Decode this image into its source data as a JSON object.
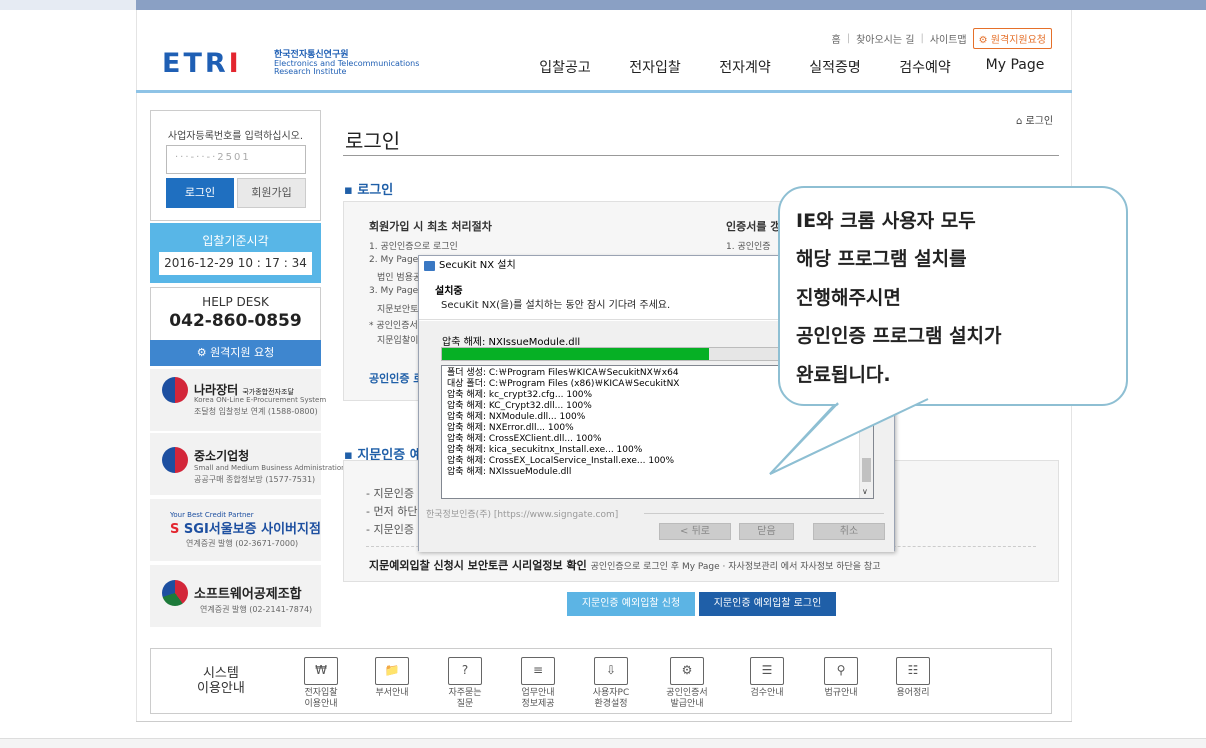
{
  "header": {
    "logo_text_a": "ETR",
    "logo_text_b": "I",
    "logo_org_kr": "한국전자통신연구원",
    "logo_org_en1": "Electronics and Telecommunications",
    "logo_org_en2": "Research Institute",
    "top_links": [
      "홈",
      "찾아오시는 길",
      "사이트맵"
    ],
    "remote_support": "원격지원요청",
    "nav": [
      "입찰공고",
      "전자입찰",
      "전자계약",
      "실적증명",
      "검수예약",
      "My Page"
    ]
  },
  "sidebar": {
    "login_prompt": "사업자등록번호를 입력하십시오.",
    "login_value": "···-··-·2501",
    "login_button": "로그인",
    "join_button": "회원가입",
    "time_title": "입찰기준시각",
    "time_value": "2016-12-29 10 : 17 : 34",
    "help_title": "HELP DESK",
    "help_phone": "042-860-0859",
    "help_remote": "원격지원 요청",
    "banners": [
      {
        "name": "나라장터",
        "tag": "국가종합전자조달",
        "sub": "Korea ON-Line E-Procurement System",
        "sub2": "조달청 입찰정보 연계 (1588-0800)"
      },
      {
        "name": "중소기업청",
        "sub": "Small and Medium Business Administration",
        "sub2": "공공구매 종합정보망 (1577-7531)"
      },
      {
        "name": "SGI서울보증 사이버지점",
        "tag": "Your Best Credit Partner",
        "sub2": "연계증권 발행 (02-3671-7000)"
      },
      {
        "name": "소프트웨어공제조합",
        "sub2": "연계증권 발행 (02-2141-7874)"
      }
    ]
  },
  "main": {
    "breadcrumb": "로그인",
    "title": "로그인",
    "section_login": "로그인",
    "proc_title": "회원가입 시 최초 처리절차",
    "proc_lines": [
      "1. 공인인증으로 로그인",
      "2. My Page –",
      "법인 범용공",
      "3. My Page –",
      "지문보안토",
      "* 공인인증서",
      "지문입찰이"
    ],
    "cert_title": "인증서를 갱",
    "cert_line1": "1. 공인인증",
    "cert_link": "공인인증 로",
    "section_fp": "지문인증 예",
    "fp_lines": [
      "- 지문인증",
      "- 먼저 하단",
      "- 지문인증"
    ],
    "fp_notice_bold": "지문예외입찰 신청시 보안토큰 시리얼정보 확인",
    "fp_notice_small": "공인인증으로 로그인 후 My Page  · 자사정보관리 에서 자사정보 하단을 참고",
    "fp_btn_apply": "지문인증 예외입찰 신청",
    "fp_btn_login": "지문인증 예외입찰 로그인"
  },
  "sysbar": {
    "title1": "시스템",
    "title2": "이용안내",
    "items": [
      {
        "icon": "₩",
        "l1": "전자입찰",
        "l2": "이용안내"
      },
      {
        "icon": "📁",
        "l1": "부서안내",
        "l2": ""
      },
      {
        "icon": "?",
        "l1": "자주묻는",
        "l2": "질문"
      },
      {
        "icon": "≡",
        "l1": "업무안내",
        "l2": "정보제공"
      },
      {
        "icon": "⇩",
        "l1": "사용자PC",
        "l2": "환경설정"
      },
      {
        "icon": "⚙",
        "l1": "공인인증서",
        "l2": "발급안내"
      },
      {
        "icon": "☰",
        "l1": "검수안내",
        "l2": ""
      },
      {
        "icon": "⚲",
        "l1": "법규안내",
        "l2": ""
      },
      {
        "icon": "☷",
        "l1": "용어정리",
        "l2": ""
      }
    ]
  },
  "dialog": {
    "title": "SecuKit NX 설치",
    "heading": "설치중",
    "subtext": "SecuKit NX(을)를 설치하는 동안 잠시 기다려 주세요.",
    "current": "압축 해제: NXIssueModule.dll",
    "progress": 0.62,
    "log": [
      "폴더 생성: C:￦Program Files￦KICA￦SecukitNX￦x64",
      "대상 폴더: C:￦Program Files (x86)￦KICA￦SecukitNX",
      "압축 해제: kc_crypt32.cfg... 100%",
      "압축 해제: KC_Crypt32.dll... 100%",
      "압축 해제: NXModule.dll... 100%",
      "압축 해제: NXError.dll... 100%",
      "압축 해제: CrossEXClient.dll... 100%",
      "압축 해제: kica_secukitnx_Install.exe... 100%",
      "압축 해제: CrossEX_LocalService_Install.exe... 100%",
      "압축 해제: NXIssueModule.dll"
    ],
    "company": "한국정보인증(주) [https://www.signgate.com]",
    "btn_back": "< 뒤로",
    "btn_close": "닫음",
    "btn_cancel": "취소"
  },
  "callout": {
    "lines": [
      "IE와 크롬 사용자 모두",
      "해당 프로그램 설치를",
      "진행해주시면",
      "공인인증 프로그램 설치가",
      "완료됩니다."
    ]
  },
  "colors": {
    "brand_blue": "#1f5fb4",
    "brand_red": "#e3262f",
    "accent_sky": "#58b6e7",
    "progress_green": "#06b025",
    "callout_border": "#8ebfd3"
  }
}
